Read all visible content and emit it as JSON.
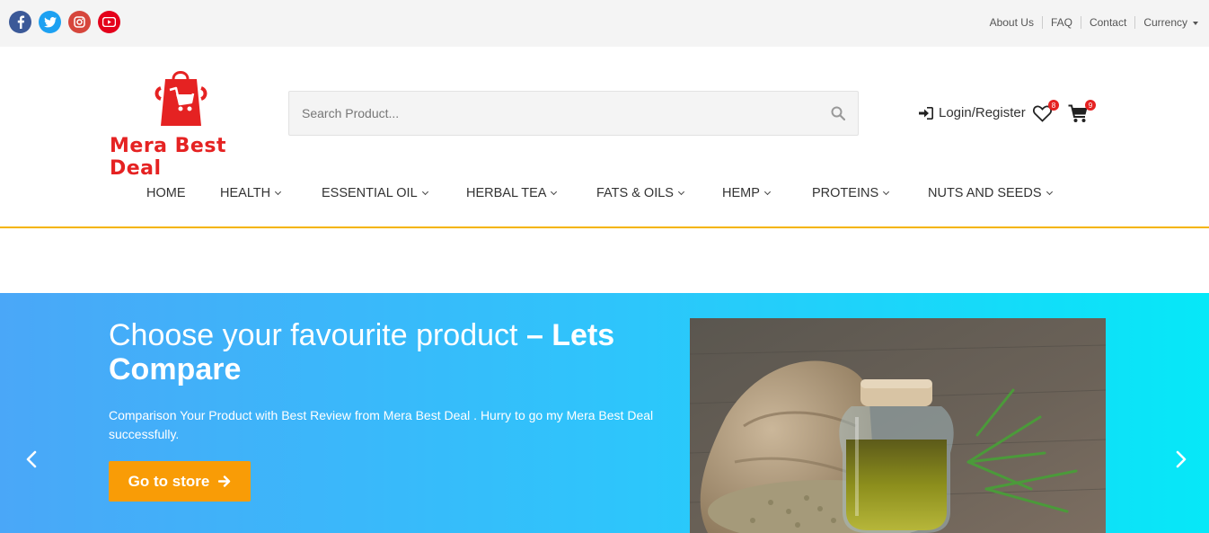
{
  "social": [
    {
      "name": "facebook",
      "icon": "facebook-icon",
      "color": "#3b5998"
    },
    {
      "name": "twitter",
      "icon": "twitter-icon",
      "color": "#1da1f2"
    },
    {
      "name": "instagram",
      "icon": "instagram-icon",
      "color": "#d6463c"
    },
    {
      "name": "youtube",
      "icon": "youtube-icon",
      "color": "#e4001b"
    }
  ],
  "toplinks": {
    "about": "About Us",
    "faq": "FAQ",
    "contact": "Contact",
    "currency": "Currency"
  },
  "brand": {
    "name": "Mera Best Deal",
    "color": "#e52222"
  },
  "search": {
    "placeholder": "Search Product..."
  },
  "account": {
    "login_label": "Login/Register",
    "wishlist_count": "8",
    "cart_count": "9"
  },
  "nav": {
    "home": "HOME",
    "health": "HEALTH",
    "essential_oil": "ESSENTIAL OIL",
    "herbal_tea": "HERBAL TEA",
    "fats_oils": "FATS & OILS",
    "hemp": "HEMP",
    "proteins": "PROTEINS",
    "nuts_seeds": "NUTS AND SEEDS"
  },
  "hero": {
    "title_light": "Choose your favourite product ",
    "title_bold": "– Lets Compare",
    "description": "Comparison Your Product with Best Review from Mera Best Deal . Hurry to go my Mera Best Deal successfully.",
    "button_label": "Go to store",
    "accent": "#f99c06"
  }
}
